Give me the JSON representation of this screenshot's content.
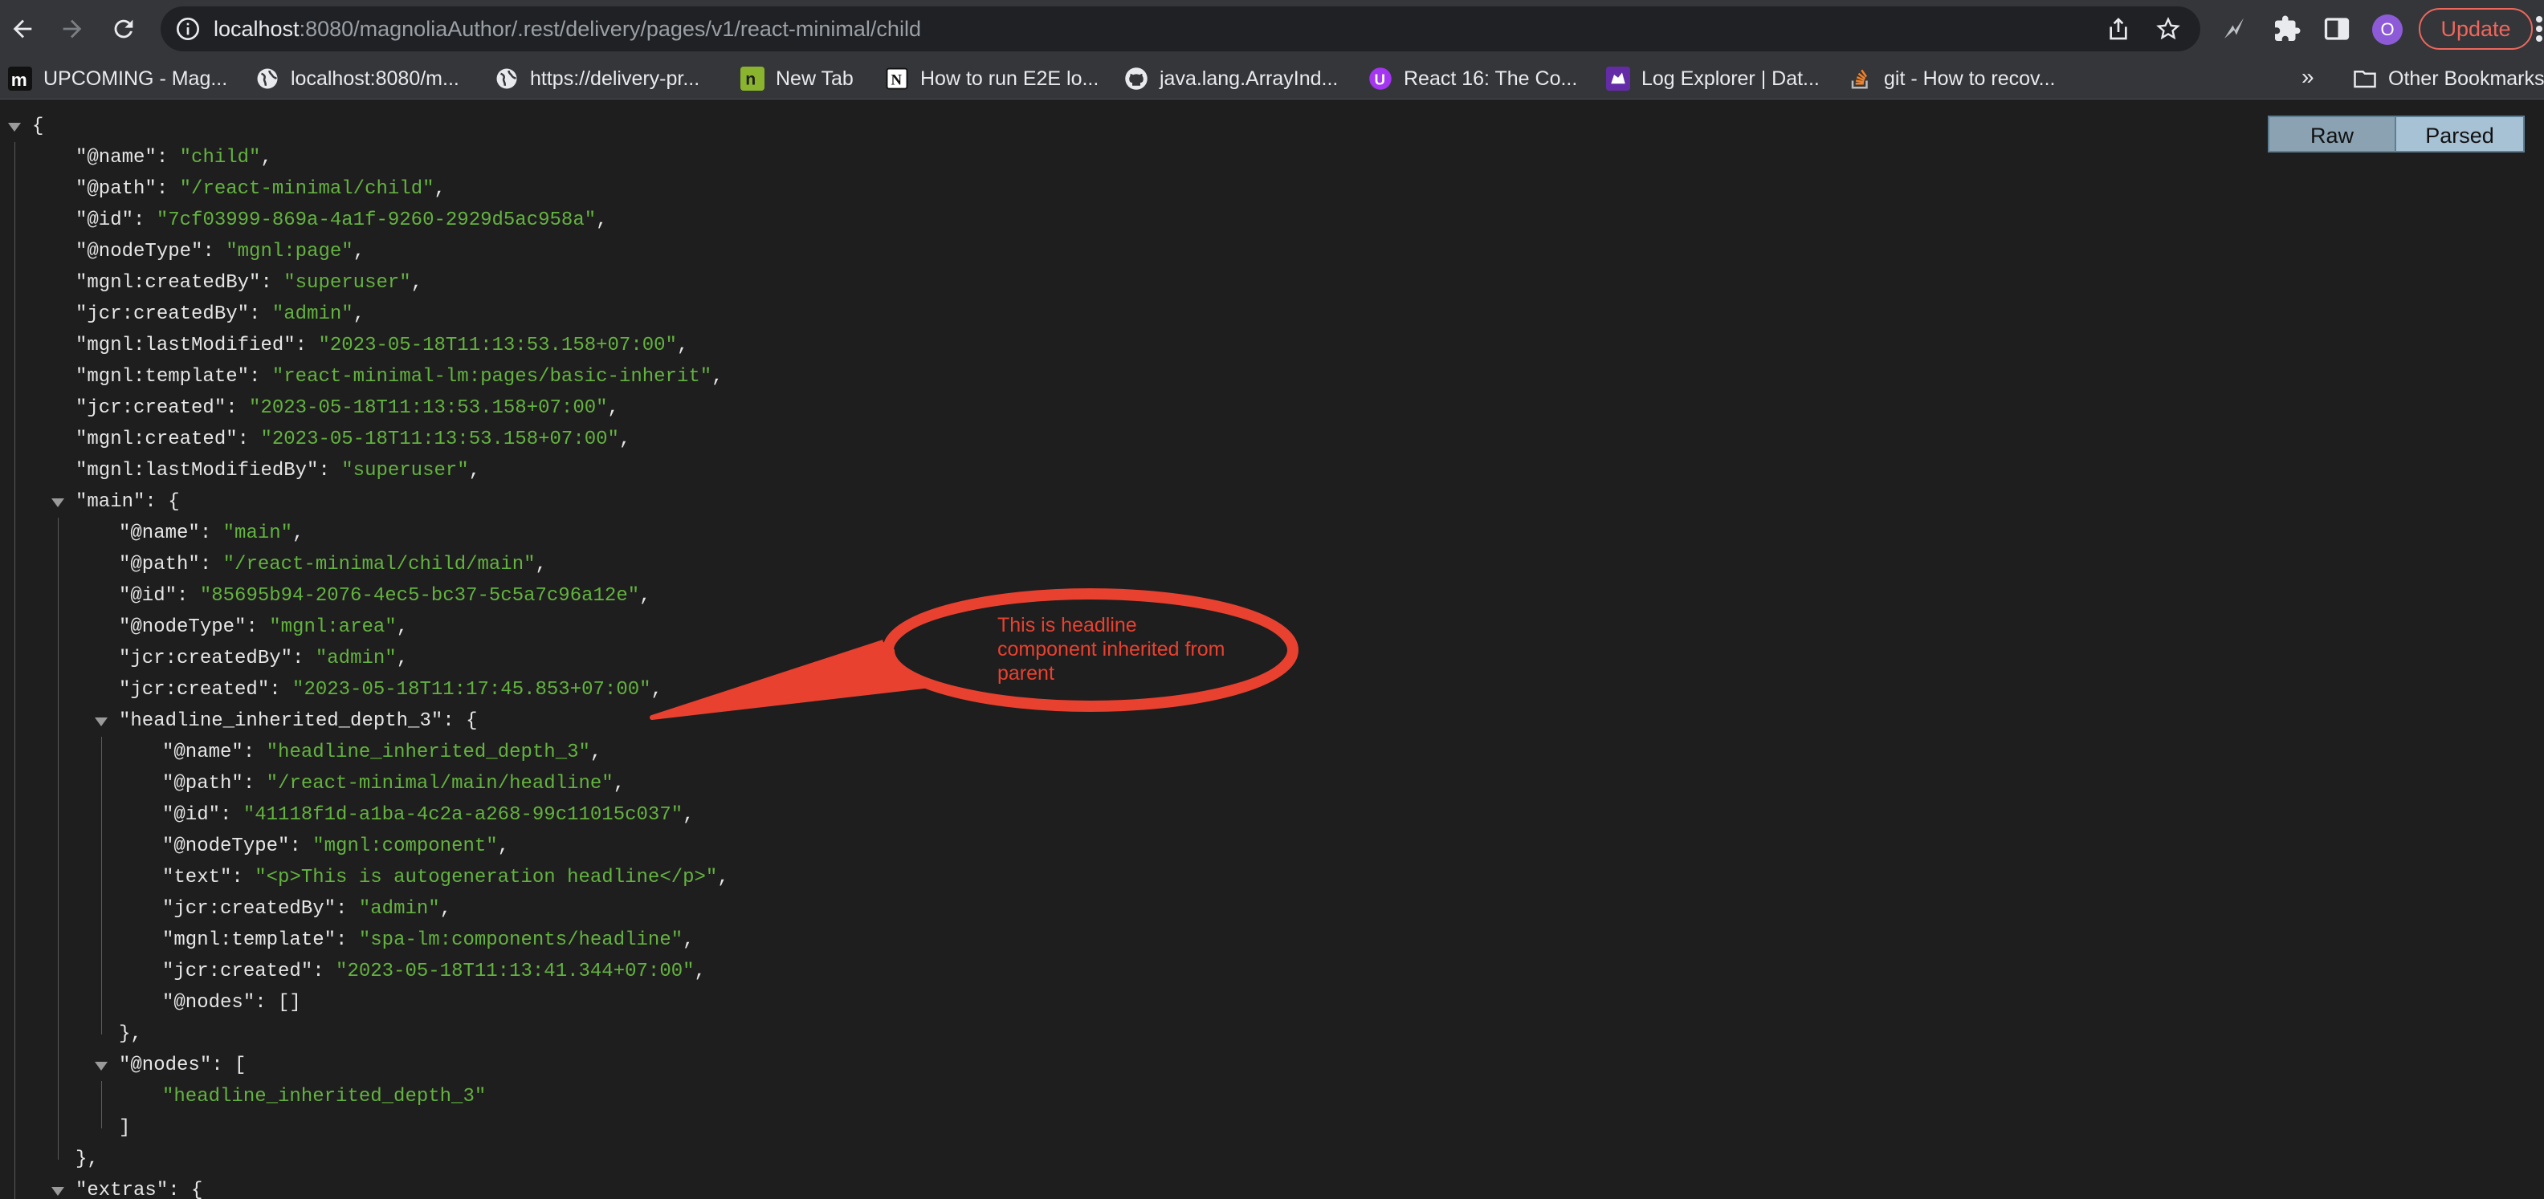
{
  "browser": {
    "url_host": "localhost",
    "url_rest": ":8080/magnoliaAuthor/.rest/delivery/pages/v1/react-minimal/child",
    "update_label": "Update",
    "profile_initial": "O"
  },
  "bookmarks": {
    "items": [
      {
        "label": "UPCOMING - Mag...",
        "icon": "m-logo-icon"
      },
      {
        "label": "localhost:8080/m...",
        "icon": "globe-icon"
      },
      {
        "label": "https://delivery-pr...",
        "icon": "globe-icon"
      },
      {
        "label": "New Tab",
        "icon": "n-green-icon"
      },
      {
        "label": "How to run E2E lo...",
        "icon": "notion-icon"
      },
      {
        "label": "java.lang.ArrayInd...",
        "icon": "github-icon"
      },
      {
        "label": "React 16: The Co...",
        "icon": "udemy-icon"
      },
      {
        "label": "Log Explorer | Dat...",
        "icon": "datadog-icon"
      },
      {
        "label": "git - How to recov...",
        "icon": "stackoverflow-icon"
      }
    ],
    "more": "»",
    "other_label": "Other Bookmarks"
  },
  "viewer": {
    "raw_label": "Raw",
    "parsed_label": "Parsed"
  },
  "json_lines": [
    {
      "indent": 0,
      "open": "{"
    },
    {
      "indent": 1,
      "key": "\"@name\"",
      "value": "\"child\"",
      "punct": ","
    },
    {
      "indent": 1,
      "key": "\"@path\"",
      "value": "\"/react-minimal/child\"",
      "punct": ","
    },
    {
      "indent": 1,
      "key": "\"@id\"",
      "value": "\"7cf03999-869a-4a1f-9260-2929d5ac958a\"",
      "punct": ","
    },
    {
      "indent": 1,
      "key": "\"@nodeType\"",
      "value": "\"mgnl:page\"",
      "punct": ","
    },
    {
      "indent": 1,
      "key": "\"mgnl:createdBy\"",
      "value": "\"superuser\"",
      "punct": ","
    },
    {
      "indent": 1,
      "key": "\"jcr:createdBy\"",
      "value": "\"admin\"",
      "punct": ","
    },
    {
      "indent": 1,
      "key": "\"mgnl:lastModified\"",
      "value": "\"2023-05-18T11:13:53.158+07:00\"",
      "punct": ","
    },
    {
      "indent": 1,
      "key": "\"mgnl:template\"",
      "value": "\"react-minimal-lm:pages/basic-inherit\"",
      "punct": ","
    },
    {
      "indent": 1,
      "key": "\"jcr:created\"",
      "value": "\"2023-05-18T11:13:53.158+07:00\"",
      "punct": ","
    },
    {
      "indent": 1,
      "key": "\"mgnl:created\"",
      "value": "\"2023-05-18T11:13:53.158+07:00\"",
      "punct": ","
    },
    {
      "indent": 1,
      "key": "\"mgnl:lastModifiedBy\"",
      "value": "\"superuser\"",
      "punct": ","
    },
    {
      "indent": 1,
      "key": "\"main\"",
      "open": "{"
    },
    {
      "indent": 2,
      "key": "\"@name\"",
      "value": "\"main\"",
      "punct": ","
    },
    {
      "indent": 2,
      "key": "\"@path\"",
      "value": "\"/react-minimal/child/main\"",
      "punct": ","
    },
    {
      "indent": 2,
      "key": "\"@id\"",
      "value": "\"85695b94-2076-4ec5-bc37-5c5a7c96a12e\"",
      "punct": ","
    },
    {
      "indent": 2,
      "key": "\"@nodeType\"",
      "value": "\"mgnl:area\"",
      "punct": ","
    },
    {
      "indent": 2,
      "key": "\"jcr:createdBy\"",
      "value": "\"admin\"",
      "punct": ","
    },
    {
      "indent": 2,
      "key": "\"jcr:created\"",
      "value": "\"2023-05-18T11:17:45.853+07:00\"",
      "punct": ","
    },
    {
      "indent": 2,
      "key": "\"headline_inherited_depth_3\"",
      "open": "{"
    },
    {
      "indent": 3,
      "key": "\"@name\"",
      "value": "\"headline_inherited_depth_3\"",
      "punct": ","
    },
    {
      "indent": 3,
      "key": "\"@path\"",
      "value": "\"/react-minimal/main/headline\"",
      "punct": ","
    },
    {
      "indent": 3,
      "key": "\"@id\"",
      "value": "\"41118f1d-a1ba-4c2a-a268-99c11015c037\"",
      "punct": ","
    },
    {
      "indent": 3,
      "key": "\"@nodeType\"",
      "value": "\"mgnl:component\"",
      "punct": ","
    },
    {
      "indent": 3,
      "key": "\"text\"",
      "value": "\"<p>This is autogeneration headline</p>\"",
      "punct": ","
    },
    {
      "indent": 3,
      "key": "\"jcr:createdBy\"",
      "value": "\"admin\"",
      "punct": ","
    },
    {
      "indent": 3,
      "key": "\"mgnl:template\"",
      "value": "\"spa-lm:components/headline\"",
      "punct": ","
    },
    {
      "indent": 3,
      "key": "\"jcr:created\"",
      "value": "\"2023-05-18T11:13:41.344+07:00\"",
      "punct": ","
    },
    {
      "indent": 3,
      "key": "\"@nodes\"",
      "plain": "[]"
    },
    {
      "indent": 2,
      "close": "},"
    },
    {
      "indent": 2,
      "key": "\"@nodes\"",
      "open": "["
    },
    {
      "indent": 3,
      "value": "\"headline_inherited_depth_3\""
    },
    {
      "indent": 2,
      "close": "]"
    },
    {
      "indent": 1,
      "close": "},"
    },
    {
      "indent": 1,
      "key": "\"extras\"",
      "open": "{"
    }
  ],
  "annotation": {
    "text": "This is headline component inherited from parent",
    "color": "#e8412f"
  },
  "colors": {
    "string": "#63b33f",
    "key": "#e6e6e6",
    "background": "#1e1e1e"
  }
}
